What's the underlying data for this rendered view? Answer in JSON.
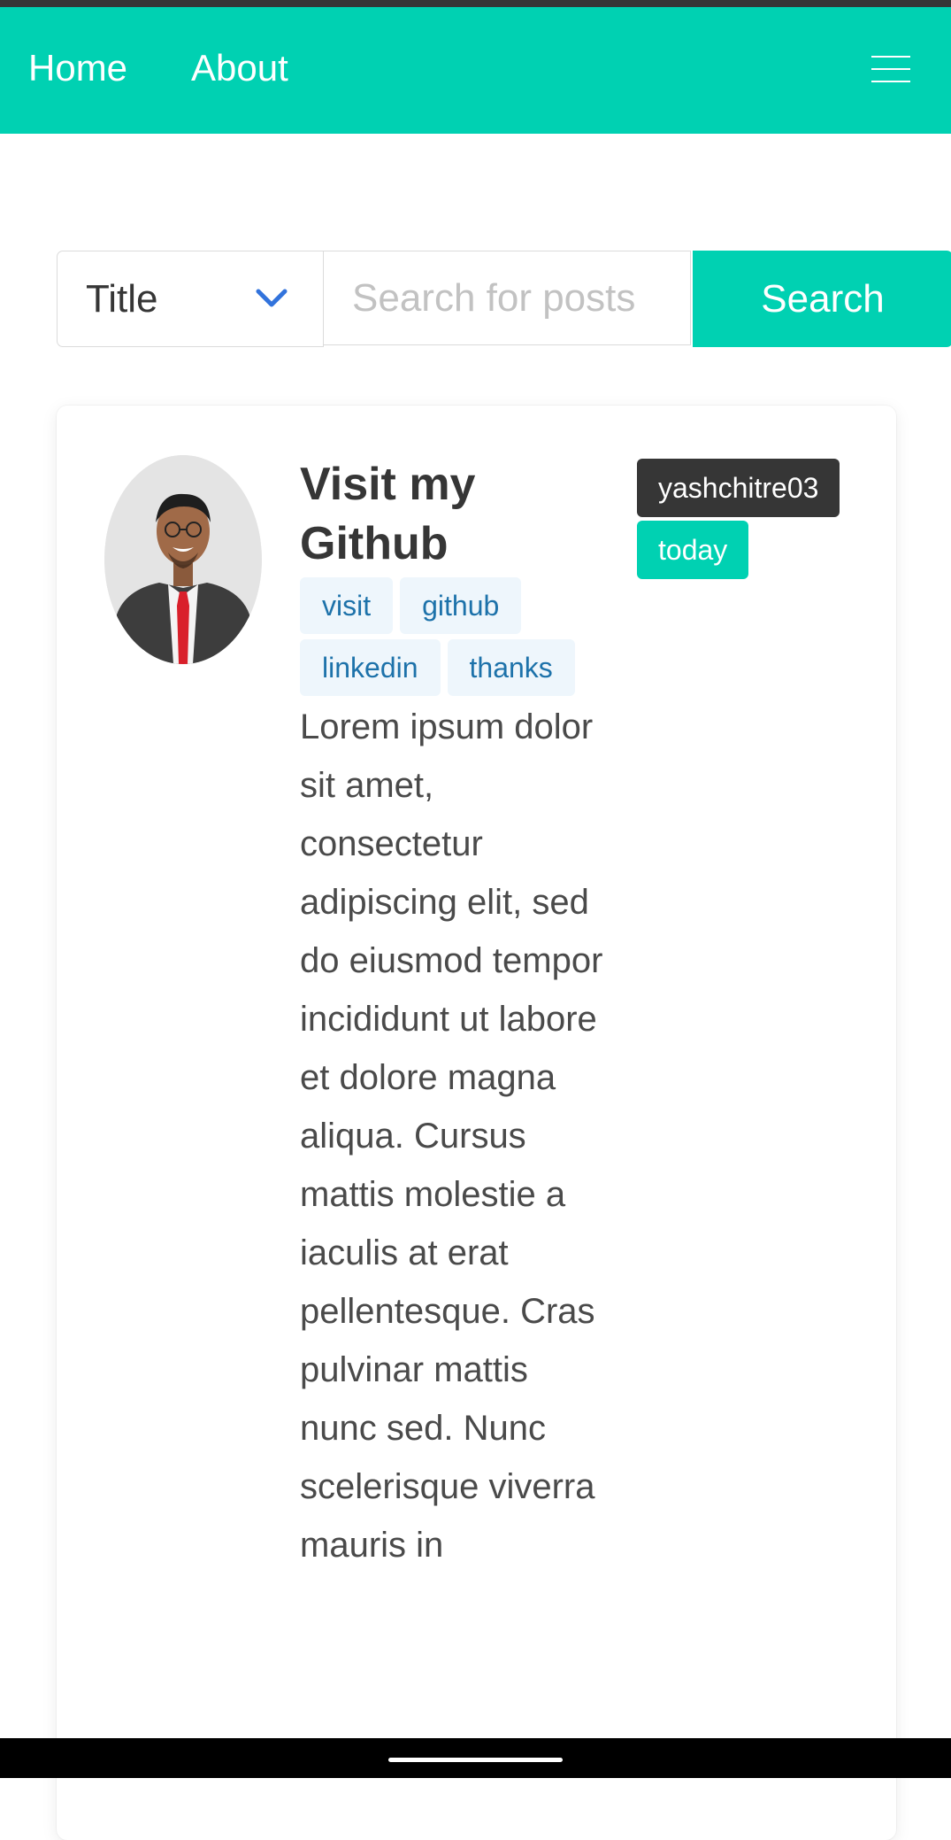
{
  "nav": {
    "home_label": "Home",
    "about_label": "About",
    "menu_icon": "hamburger-menu-icon",
    "background_color": "#00d1b2"
  },
  "search": {
    "field_select_value": "Title",
    "placeholder": "Search for posts",
    "value": "",
    "button_label": "Search"
  },
  "post": {
    "title": "Visit my Github",
    "tags": [
      "visit",
      "github",
      "linkedin",
      "thanks"
    ],
    "author": "yashchitre03",
    "date": "today",
    "body": "Lorem ipsum dolor sit amet, consectetur adipiscing elit, sed do eiusmod tempor incididunt ut labore et dolore magna aliqua. Cursus mattis molestie a iaculis at erat pellentesque. Cras pulvinar mattis nunc sed. Nunc scelerisque viverra mauris in"
  },
  "colors": {
    "primary": "#00d1b2",
    "dark": "#363636",
    "tag_bg": "#eef6fc",
    "tag_text": "#1d72aa",
    "chevron": "#3273dc"
  }
}
